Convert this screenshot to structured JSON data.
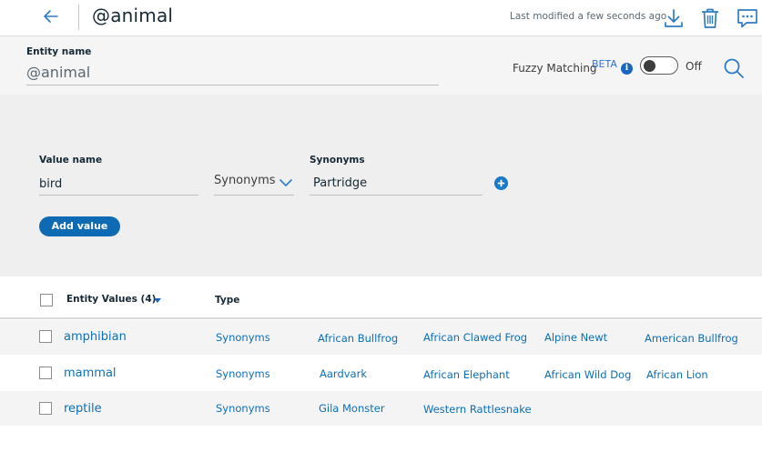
{
  "header": {
    "title": "@animal",
    "last_modified": "Last modified a few seconds ago"
  },
  "entity": {
    "label": "Entity name",
    "value": "@animal",
    "fuzzy_label": "Fuzzy Matching",
    "beta": "BETA",
    "info": "i",
    "fuzzy_state": "Off"
  },
  "add_value": {
    "value_label": "Value name",
    "value": "bird",
    "type_selected": "Synonyms",
    "synonyms_label": "Synonyms",
    "synonym_value": "Partridge",
    "add_button": "Add value"
  },
  "table": {
    "col_values": "Entity Values (4)",
    "col_type": "Type",
    "rows": [
      {
        "name": "amphibian",
        "type": "Synonyms",
        "synonyms": [
          "African Bullfrog",
          "African Clawed Frog",
          "Alpine Newt",
          "American Bullfrog"
        ]
      },
      {
        "name": "mammal",
        "type": "Synonyms",
        "synonyms": [
          "Aardvark",
          "African Elephant",
          "African Wild Dog",
          "African Lion"
        ]
      },
      {
        "name": "reptile",
        "type": "Synonyms",
        "synonyms": [
          "Gila Monster",
          "Western Rattlesnake"
        ]
      }
    ]
  },
  "colors": {
    "accent": "#0e6bb3",
    "link": "#0d6fb8",
    "panel_bg": "#efefef",
    "row_alt_bg": "#f4f4f4"
  },
  "icons": {
    "back": "arrow-left-icon",
    "download": "download-icon",
    "delete": "trash-icon",
    "feedback": "chat-icon",
    "search": "search-icon",
    "add": "plus-circle-icon",
    "dropdown": "chevron-down-icon",
    "sort": "caret-down-icon"
  }
}
